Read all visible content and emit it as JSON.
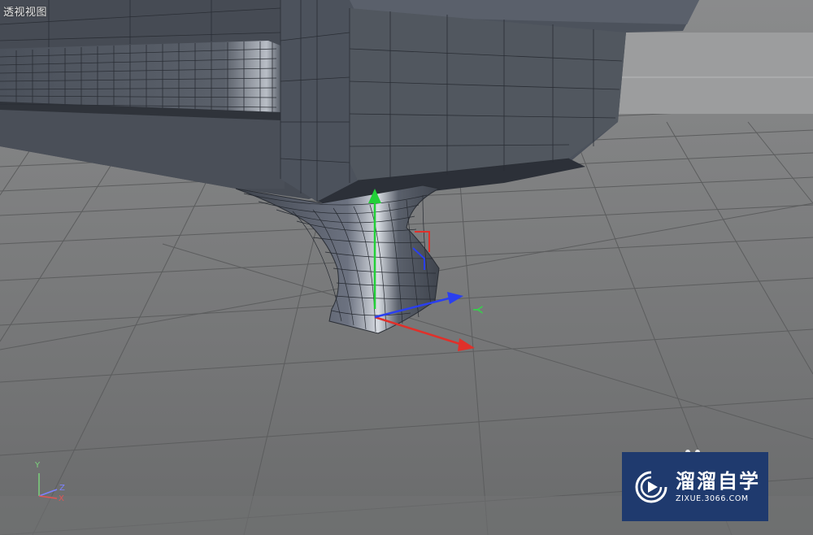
{
  "viewport": {
    "label": "透视视图",
    "object": "sofa leg mesh"
  },
  "gizmo": {
    "axis_label": "Y"
  },
  "corner_axes": {
    "y": "Y",
    "z": "Z",
    "x": "X"
  },
  "watermark": {
    "name": "溜溜自学",
    "url": "ZIXUE.3066.COM",
    "icon": "play-logo-icon"
  },
  "colors": {
    "background": "#6e7071",
    "mesh": "#4a4f58",
    "axis_x": "#e0302a",
    "axis_y": "#22d038",
    "axis_z": "#2a3ff0",
    "watermark_bg": "#1f3a6e"
  }
}
